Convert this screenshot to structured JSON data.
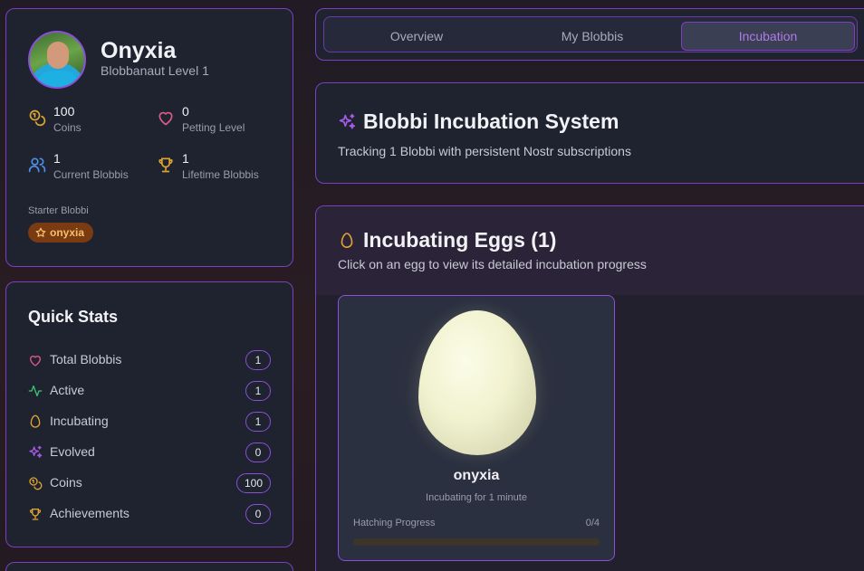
{
  "profile": {
    "name": "Onyxia",
    "level": "Blobbanaut Level 1",
    "stats": [
      {
        "icon": "coins-icon",
        "value": "100",
        "label": "Coins"
      },
      {
        "icon": "heart-icon",
        "value": "0",
        "label": "Petting Level"
      },
      {
        "icon": "users-icon",
        "value": "1",
        "label": "Current Blobbis"
      },
      {
        "icon": "trophy-icon",
        "value": "1",
        "label": "Lifetime Blobbis"
      }
    ],
    "starter_label": "Starter Blobbi",
    "starter_name": "onyxia"
  },
  "quick_stats": {
    "title": "Quick Stats",
    "rows": [
      {
        "icon": "heart-icon",
        "label": "Total Blobbis",
        "count": "1"
      },
      {
        "icon": "activity-icon",
        "label": "Active",
        "count": "1"
      },
      {
        "icon": "egg-icon",
        "label": "Incubating",
        "count": "1"
      },
      {
        "icon": "sparkles-icon",
        "label": "Evolved",
        "count": "0"
      },
      {
        "icon": "coins-icon",
        "label": "Coins",
        "count": "100"
      },
      {
        "icon": "trophy-icon",
        "label": "Achievements",
        "count": "0"
      }
    ]
  },
  "tabs": [
    {
      "label": "Overview",
      "active": false
    },
    {
      "label": "My Blobbis",
      "active": false
    },
    {
      "label": "Incubation",
      "active": true
    }
  ],
  "system": {
    "title": "Blobbi Incubation System",
    "subtitle": "Tracking 1 Blobbi with persistent Nostr subscriptions"
  },
  "eggs": {
    "title": "Incubating Eggs (1)",
    "subtitle": "Click on an egg to view its detailed incubation progress",
    "items": [
      {
        "name": "onyxia",
        "status": "Incubating for 1 minute",
        "progress_label": "Hatching Progress",
        "progress_value": "0/4",
        "progress_fraction": 0
      }
    ]
  },
  "colors": {
    "accent": "#8b4fd8",
    "accent_text": "#b07ae8",
    "gold": "#e0a431",
    "pink": "#e05a8a",
    "green": "#3ec46d",
    "blue": "#4f8fe8"
  }
}
